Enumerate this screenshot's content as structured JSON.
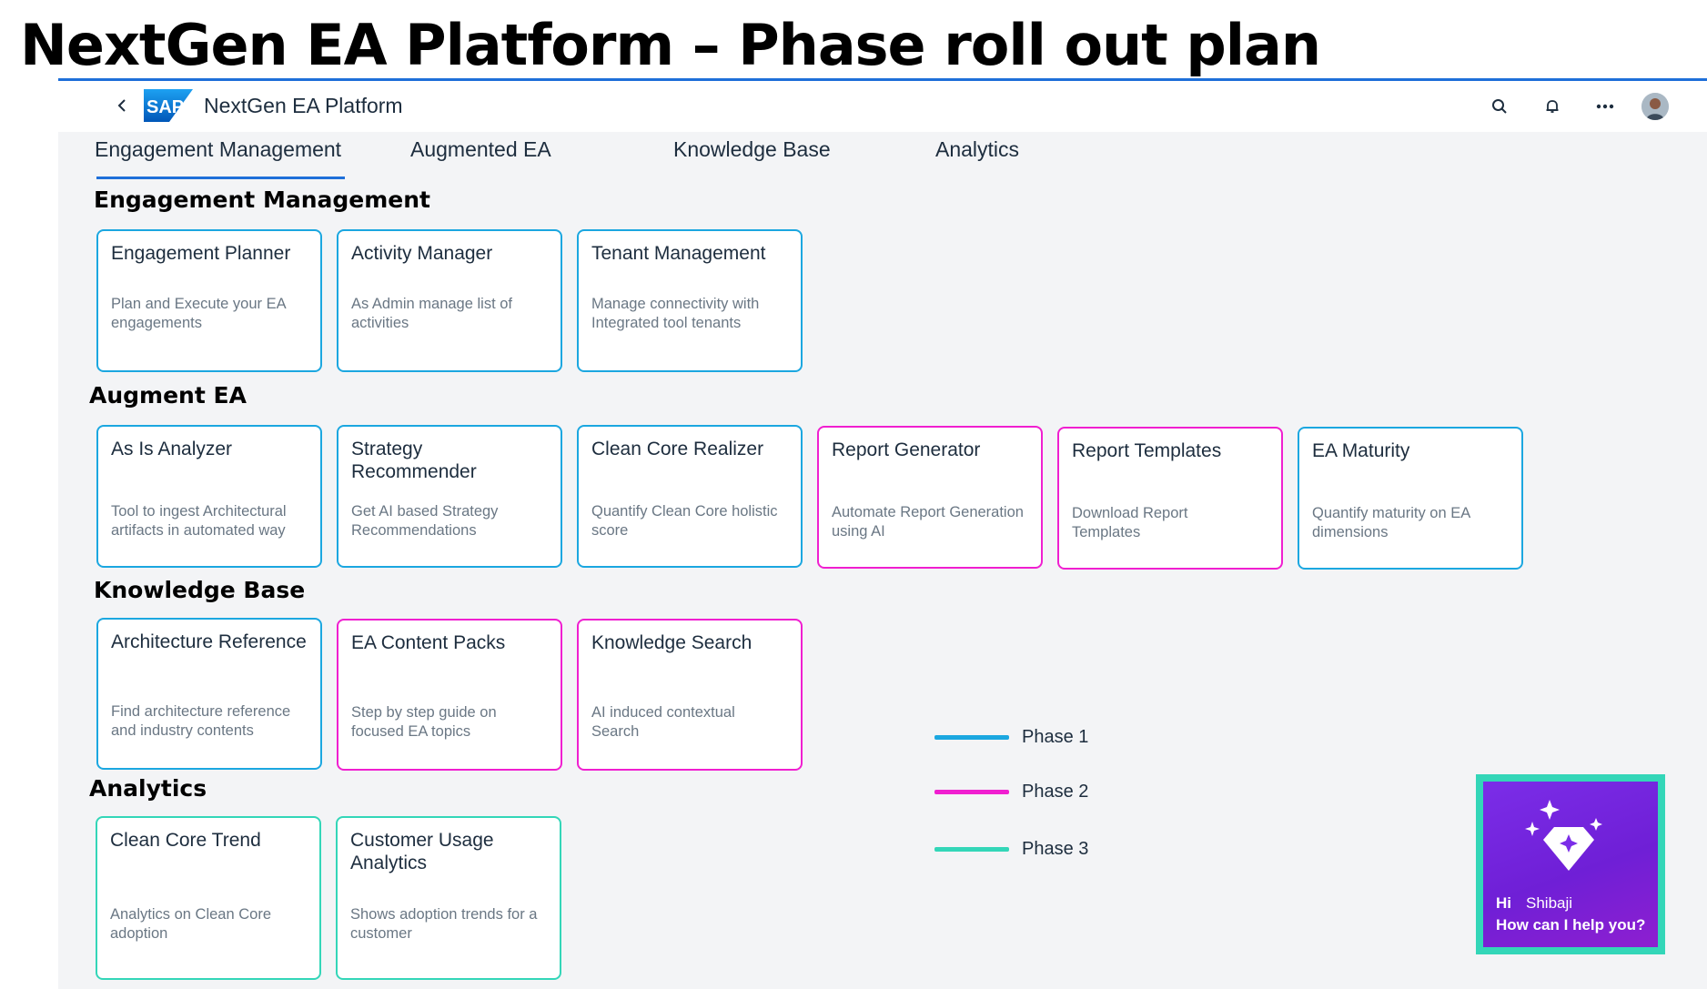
{
  "slide": {
    "title": "NextGen EA Platform – Phase roll out plan"
  },
  "colors": {
    "accent": "#1E6FD9",
    "phase1": "#1BA7E0",
    "phase2": "#F01FD0",
    "phase3": "#33D6B8",
    "assistant_bg": "#7B2DE8"
  },
  "shell": {
    "logo_text": "SAP",
    "app_title": "NextGen EA Platform",
    "icons": [
      "back-icon",
      "search-icon",
      "bell-icon",
      "more-icon",
      "user-avatar"
    ]
  },
  "tabs": [
    {
      "label": "Engagement Management",
      "selected": true
    },
    {
      "label": "Augmented EA",
      "selected": false
    },
    {
      "label": "Knowledge Base",
      "selected": false
    },
    {
      "label": "Analytics",
      "selected": false
    }
  ],
  "sections": [
    {
      "title": "Engagement Management",
      "cards": [
        {
          "title": "Engagement Planner",
          "description": "Plan and Execute your EA engagements",
          "phase": "Phase 1"
        },
        {
          "title": "Activity Manager",
          "description": "As Admin manage list of activities",
          "phase": "Phase 1"
        },
        {
          "title": "Tenant Management",
          "description": "Manage connectivity with Integrated tool tenants",
          "phase": "Phase 1"
        }
      ]
    },
    {
      "title": "Augment EA",
      "cards": [
        {
          "title": "As Is Analyzer",
          "description": "Tool to ingest Architectural artifacts in automated way",
          "phase": "Phase 1"
        },
        {
          "title": "Strategy Recommender",
          "description": "Get AI based Strategy Recommendations",
          "phase": "Phase 1"
        },
        {
          "title": "Clean Core Realizer",
          "description": "Quantify Clean Core holistic score",
          "phase": "Phase 1"
        },
        {
          "title": "Report Generator",
          "description": "Automate Report Generation using AI",
          "phase": "Phase 2"
        },
        {
          "title": "Report Templates",
          "description": "Download Report Templates",
          "phase": "Phase 2"
        },
        {
          "title": "EA Maturity",
          "description": "Quantify maturity on EA dimensions",
          "phase": "Phase 1"
        }
      ]
    },
    {
      "title": "Knowledge Base",
      "cards": [
        {
          "title": "Architecture Reference",
          "description": "Find architecture reference and industry contents",
          "phase": "Phase 1"
        },
        {
          "title": "EA Content Packs",
          "description": "Step by step guide on focused EA topics",
          "phase": "Phase 2"
        },
        {
          "title": "Knowledge Search",
          "description": "AI induced contextual Search",
          "phase": "Phase 2"
        }
      ]
    },
    {
      "title": "Analytics",
      "cards": [
        {
          "title": "Clean Core Trend",
          "description": "Analytics on Clean Core adoption",
          "phase": "Phase 3"
        },
        {
          "title": "Customer Usage Analytics",
          "description": "Shows adoption trends for a customer",
          "phase": "Phase 3"
        }
      ]
    }
  ],
  "legend": [
    {
      "label": "Phase 1",
      "color": "#1BA7E0"
    },
    {
      "label": "Phase 2",
      "color": "#F01FD0"
    },
    {
      "label": "Phase 3",
      "color": "#33D6B8"
    }
  ],
  "assistant": {
    "greeting": "Hi",
    "user_name": "Shibaji",
    "prompt": "How can I help you?",
    "icon": "sparkle-diamond-icon"
  }
}
